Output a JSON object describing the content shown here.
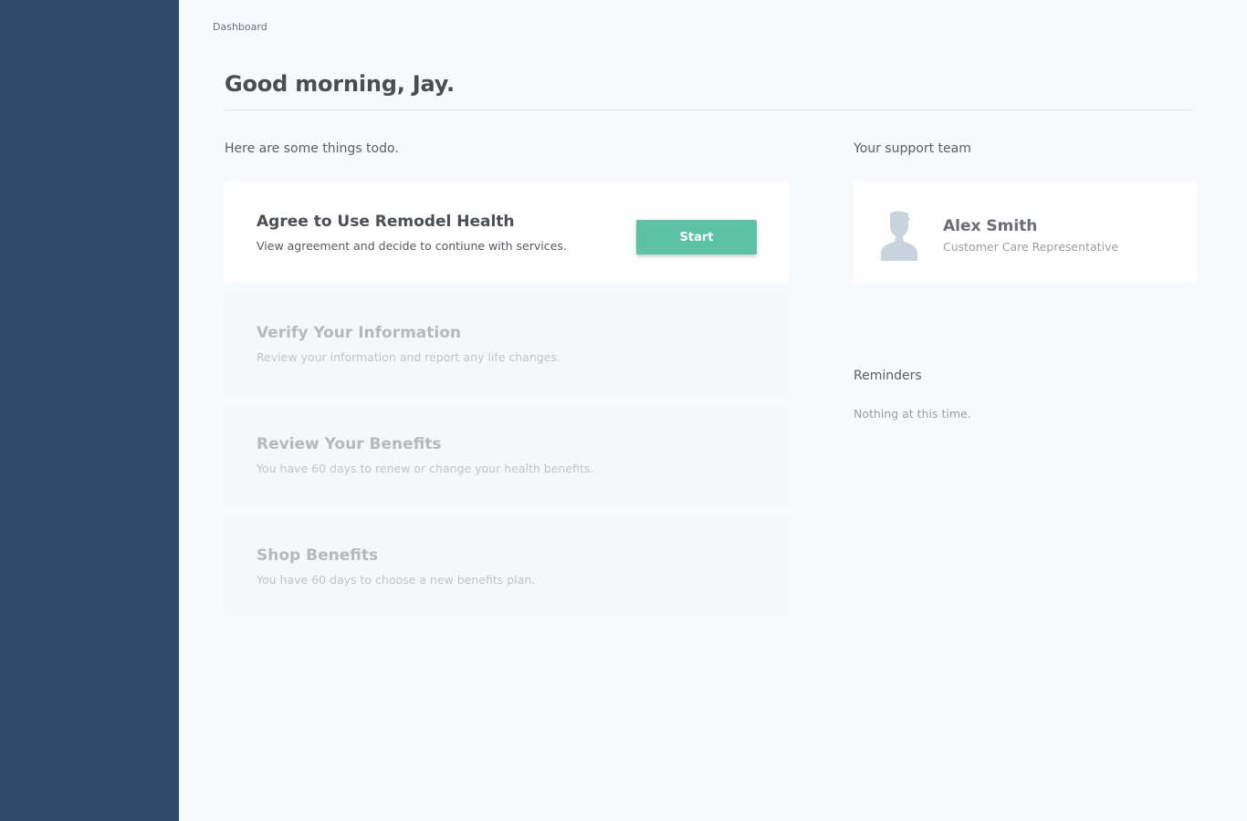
{
  "breadcrumb": "Dashboard",
  "page_title": "Good morning, Jay.",
  "todo": {
    "heading": "Here are some things todo.",
    "tasks": [
      {
        "title": "Agree to Use Remodel Health",
        "description": "View agreement and decide to contiune with services.",
        "button_label": "Start",
        "state": "active"
      },
      {
        "title": "Verify Your Information",
        "description": "Review your information and report any life changes.",
        "state": "disabled"
      },
      {
        "title": "Review Your Benefits",
        "description": "You have 60 days to renew or change your health benefits.",
        "state": "disabled"
      },
      {
        "title": "Shop Benefits",
        "description": "You have 60 days to choose a new benefits plan.",
        "state": "disabled"
      }
    ]
  },
  "support": {
    "heading": "Your support team",
    "agent": {
      "name": "Alex Smith",
      "role": "Customer Care Representative",
      "avatar_icon": "person-silhouette-icon"
    }
  },
  "reminders": {
    "heading": "Reminders",
    "empty_text": "Nothing at this time."
  },
  "colors": {
    "sidebar": "#2e4a69",
    "background": "#f8f9fd",
    "accent_button": "#5cc2a3",
    "avatar": "#c8d3dd"
  }
}
